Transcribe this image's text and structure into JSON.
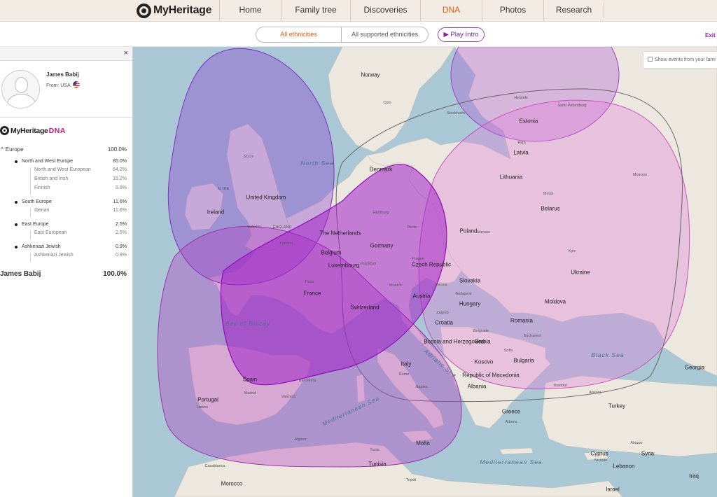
{
  "nav": {
    "brand": "MyHeritage",
    "items": [
      {
        "label": "Home",
        "active": false
      },
      {
        "label": "Family tree",
        "active": false
      },
      {
        "label": "Discoveries",
        "active": false
      },
      {
        "label": "DNA",
        "active": true
      },
      {
        "label": "Photos",
        "active": false
      },
      {
        "label": "Research",
        "active": false
      }
    ]
  },
  "subbar": {
    "tab_all": "All ethnicities",
    "tab_supported": "All supported ethnicities",
    "play_intro": "▶ Play Intro",
    "exit": "Exit f"
  },
  "panel": {
    "close": "×",
    "person": {
      "name": "James Babij",
      "from_label": "From: USA"
    },
    "dna_brand": "MyHeritage",
    "dna_suffix": "DNA",
    "region": {
      "name": "Europe",
      "percent": "100.0%"
    },
    "groups": [
      {
        "name": "North and West Europe",
        "percent": "85.0%",
        "subs": [
          {
            "name": "North and West European",
            "percent": "64.2%"
          },
          {
            "name": "British and Irish",
            "percent": "15.2%"
          },
          {
            "name": "Finnish",
            "percent": "5.6%"
          }
        ]
      },
      {
        "name": "South Europe",
        "percent": "11.6%",
        "subs": [
          {
            "name": "Iberian",
            "percent": "11.6%"
          }
        ]
      },
      {
        "name": "East Europe",
        "percent": "2.5%",
        "subs": [
          {
            "name": "East European",
            "percent": "2.5%"
          }
        ]
      },
      {
        "name": "Ashkenazi Jewish",
        "percent": "0.9%",
        "subs": [
          {
            "name": "Ashkenazi Jewish",
            "percent": "0.9%"
          }
        ]
      }
    ],
    "total": {
      "name": "James Babij",
      "percent": "100.0%"
    }
  },
  "map": {
    "events_toggle": "Show events from your fami",
    "countries": [
      "Norway",
      "Estonia",
      "Latvia",
      "Lithuania",
      "Belarus",
      "Poland",
      "Ukraine",
      "Germany",
      "Denmark",
      "The Netherlands",
      "Belgium",
      "Luxembourg",
      "Czech Republic",
      "Slovakia",
      "Austria",
      "Hungary",
      "Moldova",
      "Romania",
      "Croatia",
      "Bosnia and Herzegovina",
      "Serbia",
      "Bulgaria",
      "Kosovo",
      "Republic of Macedonia",
      "Albania",
      "Greece",
      "Turkey",
      "Georgia",
      "Switzerland",
      "France",
      "Italy",
      "Spain",
      "Portugal",
      "Ireland",
      "United Kingdom",
      "Malta",
      "Tunisia",
      "Cyprus",
      "Syria",
      "Lebanon",
      "Iraq",
      "Israel",
      "Morocco",
      "N. IRE",
      "SCOT",
      "WALES",
      "ENGLAND"
    ],
    "seas": [
      "North Sea",
      "Bay of Biscay",
      "Adriatic Sea",
      "Black Sea",
      "Mediterranean Sea",
      "Mediterranean Sea"
    ],
    "cities": [
      "Oslo",
      "Stockholm",
      "Helsinki",
      "Saint Petersburg",
      "Moscow",
      "Hamburg",
      "Berlin",
      "Frankfurt",
      "Munich",
      "Vienna",
      "Paris",
      "London",
      "Madrid",
      "Lisbon",
      "Barcelona",
      "Rome",
      "Naples",
      "Algiers",
      "Tripoli",
      "Athens",
      "Istanbul",
      "Ankara",
      "Bucharest",
      "Casablanca",
      "Nicosia",
      "Aleppo",
      "Riga",
      "Minsk",
      "Kyiv",
      "Warsaw",
      "Prague",
      "Budapest",
      "Belgrade",
      "Sofia",
      "Zagreb",
      "Tunis",
      "Valencia"
    ],
    "colors": {
      "water": "#aac7d6",
      "land": "#ede8df",
      "north_west_europe": "#a020c8",
      "british_irish": "#8a3fd0",
      "finnish": "#b05ad8",
      "south_europe": "#b040c0",
      "east_europe": "#e07bd8",
      "ashkenazi": "#555555"
    }
  }
}
